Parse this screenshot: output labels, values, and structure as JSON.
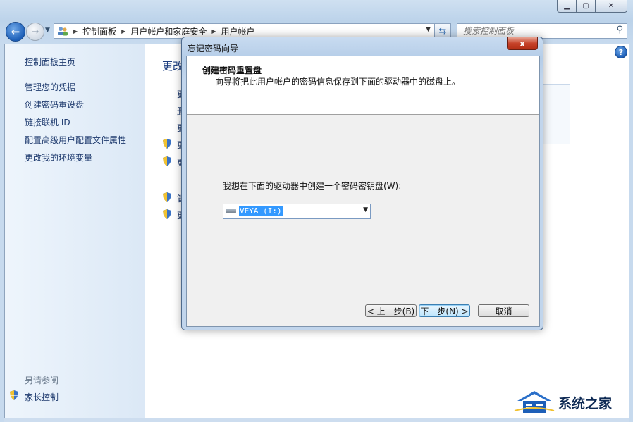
{
  "explorer": {
    "breadcrumb": [
      "控制面板",
      "用户帐户和家庭安全",
      "用户帐户"
    ],
    "search_placeholder": "搜索控制面板"
  },
  "sidebar": {
    "items": [
      "控制面板主页",
      "管理您的凭据",
      "创建密码重设盘",
      "链接联机 ID",
      "配置高级用户配置文件属性",
      "更改我的环境变量"
    ],
    "see_also": "另请参阅",
    "parental": "家长控制"
  },
  "main": {
    "heading": "更改",
    "peek_chars": [
      "更",
      "删",
      "更",
      "更",
      "更",
      "管",
      "更"
    ]
  },
  "dialog": {
    "title": "忘记密码向导",
    "close_glyph": "x",
    "header_title": "创建密码重置盘",
    "header_subtitle": "向导将把此用户帐户的密码信息保存到下面的驱动器中的磁盘上。",
    "prompt": "我想在下面的驱动器中创建一个密码密钥盘(W):",
    "drive_value": "VEYA (I:)",
    "buttons": {
      "back": "< 上一步(B)",
      "next": "下一步(N) >",
      "cancel": "取消"
    }
  },
  "watermark": {
    "text": "系统之家"
  },
  "colors": {
    "link": "#1e3a6e",
    "accent": "#1d5fb8",
    "selection": "#3399ff"
  }
}
